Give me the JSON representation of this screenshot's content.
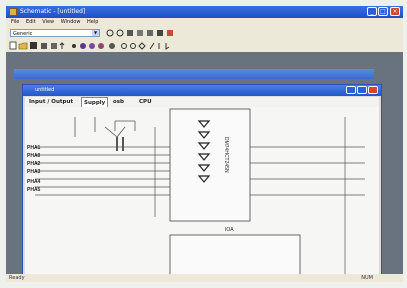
{
  "app": {
    "title": "Schematic - [untitled]"
  },
  "menu": {
    "items": [
      "File",
      "Edit",
      "View",
      "Window",
      "Help"
    ]
  },
  "toolbar": {
    "combo_value": "Generic"
  },
  "doc": {
    "title": "untitled",
    "tabs": [
      "Input / Output",
      "Supply",
      "osb",
      "CPU"
    ]
  },
  "schematic": {
    "left_labels": [
      "PHA1",
      "PHA0",
      "PHA2",
      "PHA3",
      "PHA4",
      "PHA5"
    ],
    "ic_label": "DM74HCT245N",
    "bottom_label": "IOA"
  },
  "status": {
    "left": "Ready",
    "right": "NUM"
  },
  "colors": {
    "title_blue": "#2356c8",
    "desktop": "#69737f",
    "face": "#ece9d8"
  }
}
